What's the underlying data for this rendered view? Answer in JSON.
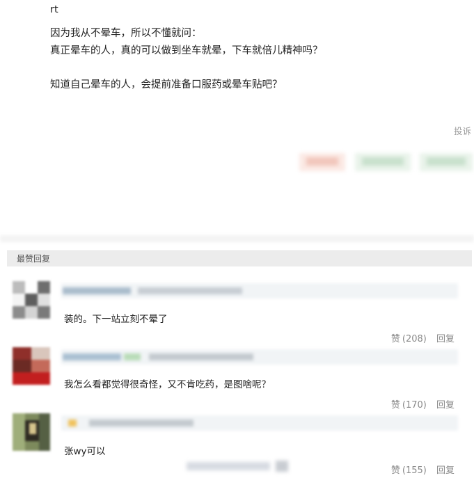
{
  "post": {
    "lines": [
      "rt",
      "因为我从不晕车，所以不懂就问：",
      "真正晕车的人，真的可以做到坐车就晕，下车就倍儿精神吗？",
      "",
      "知道自己晕车的人，会提前准备口服药或晕车贴吧？"
    ],
    "report_label": "投诉"
  },
  "replies_section": {
    "title": "最赞回复"
  },
  "replies": [
    {
      "text": "装的。下一站立刻不晕了",
      "like_label": "赞",
      "like_count": "(208)",
      "reply_label": "回复"
    },
    {
      "text": "我怎么看都觉得很奇怪，又不肯吃药，是图啥呢？",
      "like_label": "赞",
      "like_count": "(170)",
      "reply_label": "回复"
    },
    {
      "text": "张wy可以",
      "like_label": "赞",
      "like_count": "(155)",
      "reply_label": "回复"
    }
  ],
  "colors": {
    "accent_pink": "#f6d9d2",
    "accent_green": "#d6ead9",
    "muted_text": "#8a8a8a"
  }
}
